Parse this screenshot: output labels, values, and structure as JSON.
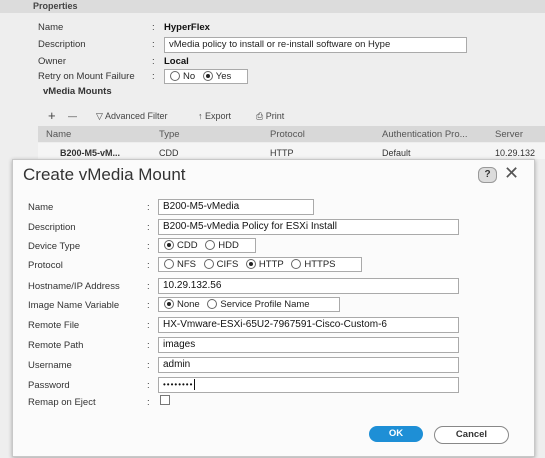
{
  "background": {
    "section_title": "Properties",
    "name_label": "Name",
    "name_value": "HyperFlex",
    "description_label": "Description",
    "description_value": "vMedia policy to install or re-install software on Hype",
    "owner_label": "Owner",
    "owner_value": "Local",
    "retry_label": "Retry on Mount Failure",
    "retry_options": [
      "No",
      "Yes"
    ],
    "retry_selected": "Yes",
    "mounts_title": "vMedia Mounts",
    "toolbar": {
      "add": "+",
      "remove": "—",
      "filter": "Advanced Filter",
      "export": "Export",
      "print": "Print"
    },
    "table": {
      "columns": [
        "Name",
        "Type",
        "Protocol",
        "Authentication Pro...",
        "Server"
      ],
      "rows": [
        [
          "B200-M5-vM...",
          "CDD",
          "HTTP",
          "Default",
          "10.29.132"
        ]
      ]
    }
  },
  "dialog": {
    "title": "Create vMedia Mount",
    "help": "?",
    "fields": {
      "name_label": "Name",
      "name_value": "B200-M5-vMedia",
      "description_label": "Description",
      "description_value": "B200-M5-vMedia Policy for ESXi Install",
      "device_type_label": "Device Type",
      "device_type_options": [
        "CDD",
        "HDD"
      ],
      "device_type_selected": "CDD",
      "protocol_label": "Protocol",
      "protocol_options": [
        "NFS",
        "CIFS",
        "HTTP",
        "HTTPS"
      ],
      "protocol_selected": "HTTP",
      "hostname_label": "Hostname/IP Address",
      "hostname_value": "10.29.132.56",
      "image_var_label": "Image Name Variable",
      "image_var_options": [
        "None",
        "Service Profile Name"
      ],
      "image_var_selected": "None",
      "remote_file_label": "Remote File",
      "remote_file_value": "HX-Vmware-ESXi-65U2-7967591-Cisco-Custom-6",
      "remote_path_label": "Remote Path",
      "remote_path_value": "images",
      "username_label": "Username",
      "username_value": "admin",
      "password_label": "Password",
      "password_value": "••••••••",
      "remap_label": "Remap on Eject",
      "remap_checked": false
    },
    "ok_label": "OK",
    "cancel_label": "Cancel"
  },
  "colors": {
    "accent": "#1e8fd6"
  }
}
